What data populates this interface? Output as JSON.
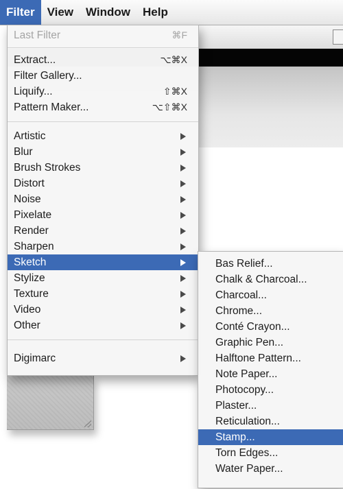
{
  "menubar": {
    "items": [
      "Filter",
      "View",
      "Window",
      "Help"
    ]
  },
  "filter_menu": {
    "last_filter": {
      "label": "Last Filter",
      "shortcut": "⌘F"
    },
    "extract": {
      "label": "Extract...",
      "shortcut": "⌥⌘X"
    },
    "filter_gallery": {
      "label": "Filter Gallery..."
    },
    "liquify": {
      "label": "Liquify...",
      "shortcut": "⇧⌘X"
    },
    "pattern_maker": {
      "label": "Pattern Maker...",
      "shortcut": "⌥⇧⌘X"
    },
    "categories": [
      "Artistic",
      "Blur",
      "Brush Strokes",
      "Distort",
      "Noise",
      "Pixelate",
      "Render",
      "Sharpen",
      "Sketch",
      "Stylize",
      "Texture",
      "Video",
      "Other"
    ],
    "digimarc": {
      "label": "Digimarc"
    },
    "highlighted": "Sketch"
  },
  "sketch_submenu": {
    "items": [
      "Bas Relief...",
      "Chalk & Charcoal...",
      "Charcoal...",
      "Chrome...",
      "Conté Crayon...",
      "Graphic Pen...",
      "Halftone Pattern...",
      "Note Paper...",
      "Photocopy...",
      "Plaster...",
      "Reticulation...",
      "Stamp...",
      "Torn Edges...",
      "Water Paper..."
    ],
    "highlighted": "Stamp..."
  },
  "colors": {
    "highlight": "#3c6ab5"
  }
}
